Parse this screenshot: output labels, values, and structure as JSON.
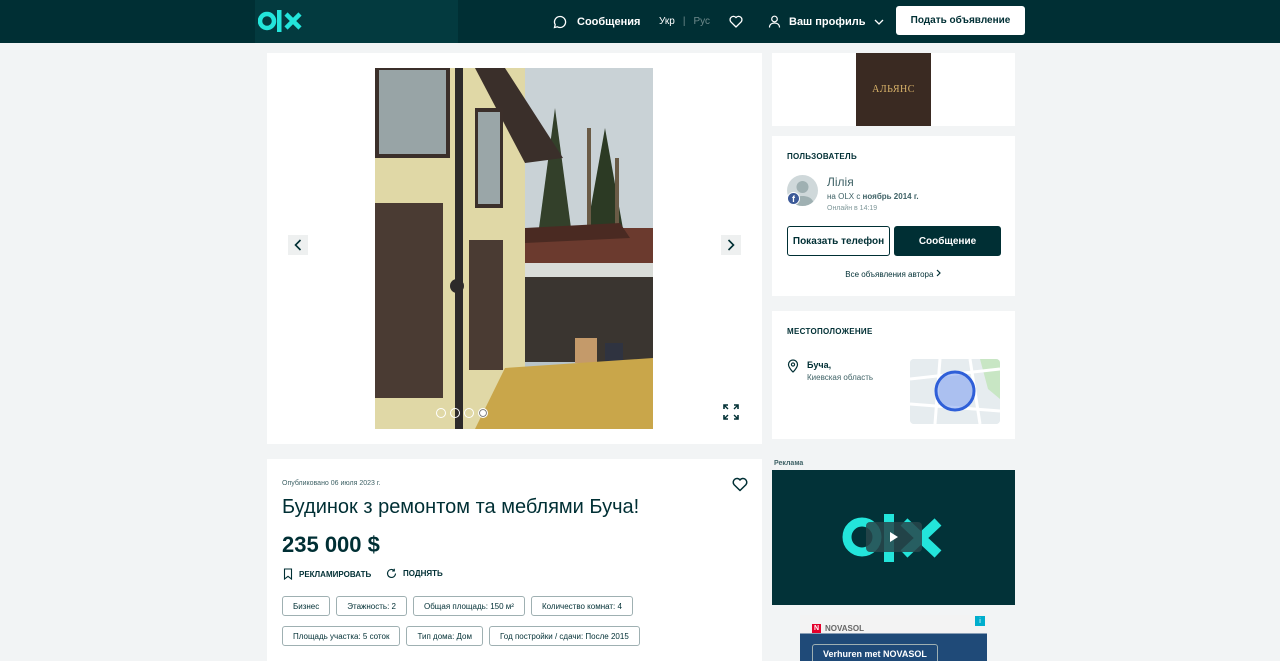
{
  "header": {
    "messages_label": "Сообщения",
    "lang_uk": "Укр",
    "lang_ru": "Рус",
    "profile_label": "Ваш профиль",
    "post_ad_label": "Подать объявление"
  },
  "gallery": {
    "total_images": 4,
    "active_index": 4
  },
  "banner_top": {
    "brand": "АЛЬЯНС"
  },
  "user": {
    "section_title": "ПОЛЬЗОВАТЕЛЬ",
    "name": "Лілія",
    "since_prefix": "на OLX с ",
    "since_date": "ноябрь 2014 г.",
    "online": "Онлайн в 14:19",
    "show_phone": "Показать телефон",
    "message": "Сообщение",
    "all_ads": "Все объявления автора"
  },
  "location": {
    "section_title": "МЕСТОПОЛОЖЕНИЕ",
    "city": "Буча,",
    "region": "Киевская область"
  },
  "ads": {
    "label": "Реклама",
    "novasol_brand": "NOVASOL",
    "novasol_tagline": "Verhuren met NOVASOL"
  },
  "listing": {
    "published": "Опубликовано 06 июля 2023 г.",
    "title": "Будинок з ремонтом та меблями Буча!",
    "price": "235 000 $",
    "promote": "РЕКЛАМИРОВАТЬ",
    "raise": "ПОДНЯТЬ",
    "tags_row1": [
      "Бизнес",
      "Этажность: 2",
      "Общая площадь: 150 м²",
      "Количество комнат: 4"
    ],
    "tags_row2": [
      "Площадь участка: 5 соток",
      "Тип дома: Дом",
      "Год постройки / сдачи: После 2015"
    ]
  },
  "colors": {
    "brand_dark": "#002f34",
    "brand_accent": "#23e5db"
  }
}
